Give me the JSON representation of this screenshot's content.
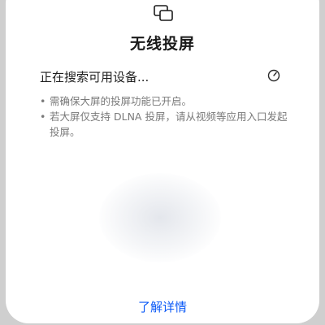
{
  "dialog": {
    "title": "无线投屏",
    "status_text": "正在搜索可用设备...",
    "tips": [
      {
        "bullet": "•",
        "text": "需确保大屏的投屏功能已开启。"
      },
      {
        "bullet": "•",
        "text": "若大屏仅支持 DLNA 投屏，请从视频等应用入口发起投屏。"
      }
    ],
    "learn_more_label": "了解详情",
    "icons": {
      "header": "screen-cast-icon",
      "status": "loading-spinner-icon"
    },
    "colors": {
      "accent": "#0a59f7",
      "title": "#1a1a1a",
      "tip_text": "#7a7a7a",
      "background": "#ffffff"
    }
  }
}
